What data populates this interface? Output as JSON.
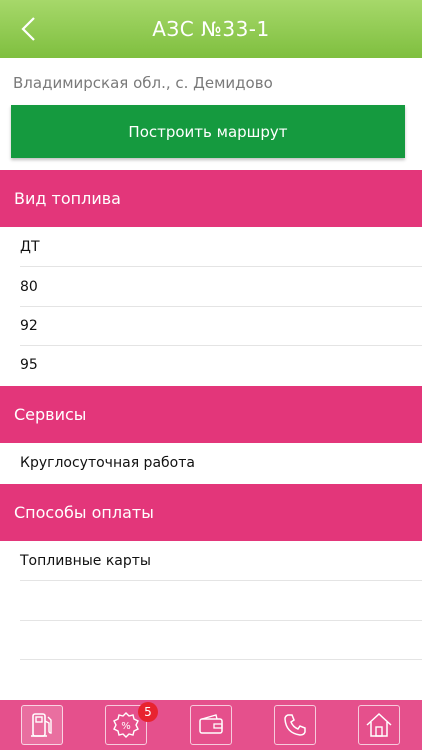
{
  "header": {
    "title": "АЗС №33-1"
  },
  "station": {
    "address": "Владимирская обл., с. Демидово",
    "route_button_label": "Построить маршрут"
  },
  "fuel": {
    "title": "Вид топлива",
    "items": [
      "ДТ",
      "80",
      "92",
      "95"
    ]
  },
  "services": {
    "title": "Сервисы",
    "items": [
      "Круглосуточная работа"
    ]
  },
  "payment": {
    "title": "Способы оплаты",
    "items": [
      "Топливные карты"
    ]
  },
  "tabbar": {
    "tabs": [
      {
        "icon": "fuel-pump-icon"
      },
      {
        "icon": "discount-icon",
        "badge": "5"
      },
      {
        "icon": "wallet-icon"
      },
      {
        "icon": "phone-icon"
      },
      {
        "icon": "home-icon"
      }
    ]
  },
  "colors": {
    "header_green": "#7fbf3f",
    "route_button": "#159a3f",
    "section_pink": "#e3367a",
    "tabbar_pink": "#e5508c",
    "badge_red": "#e8232f"
  }
}
